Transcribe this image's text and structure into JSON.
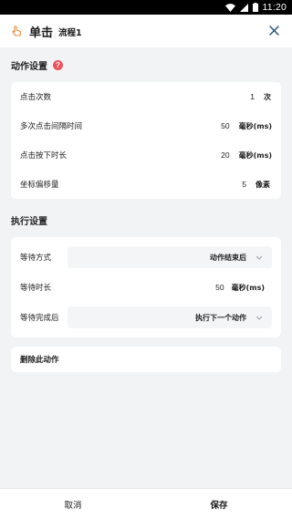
{
  "status_bar": {
    "time": "11:20",
    "icons": [
      "wifi-icon",
      "signal-icon",
      "battery-icon"
    ]
  },
  "header": {
    "title": "单击",
    "subtitle": "流程1",
    "app_icon": "tap-icon",
    "close_icon": "close-icon"
  },
  "action_settings": {
    "title": "动作设置",
    "help_icon": "?",
    "rows": [
      {
        "label": "点击次数",
        "value": "1",
        "unit": "次"
      },
      {
        "label": "多次点击间隔时间",
        "value": "50",
        "unit": "毫秒(ms)"
      },
      {
        "label": "点击按下时长",
        "value": "20",
        "unit": "毫秒(ms)"
      },
      {
        "label": "坐标偏移量",
        "value": "5",
        "unit": "像素"
      }
    ]
  },
  "exec_settings": {
    "title": "执行设置",
    "wait_mode": {
      "label": "等待方式",
      "value": "动作结束后"
    },
    "wait_time": {
      "label": "等待时长",
      "value": "50",
      "unit": "毫秒(ms)"
    },
    "after_done": {
      "label": "等待完成后",
      "value": "执行下一个动作"
    }
  },
  "delete_action": {
    "label": "删除此动作"
  },
  "footer": {
    "cancel": "取消",
    "save": "保存"
  },
  "colors": {
    "accent_red": "#f0505a",
    "background": "#f2f3f5",
    "card": "#ffffff"
  }
}
